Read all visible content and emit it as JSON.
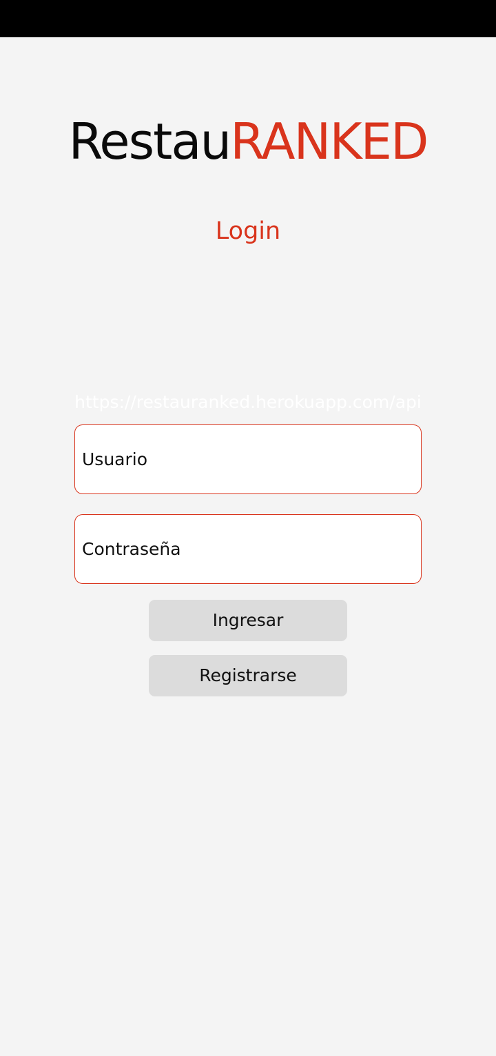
{
  "app": {
    "title_part1": "Restau",
    "title_part2": "RANKED",
    "brand_color": "#d9341c"
  },
  "login": {
    "heading": "Login",
    "api_url": "https://restauranked.herokuapp.com/api",
    "username_placeholder": "Usuario",
    "password_placeholder": "Contraseña",
    "login_button": "Ingresar",
    "register_button": "Registrarse"
  }
}
